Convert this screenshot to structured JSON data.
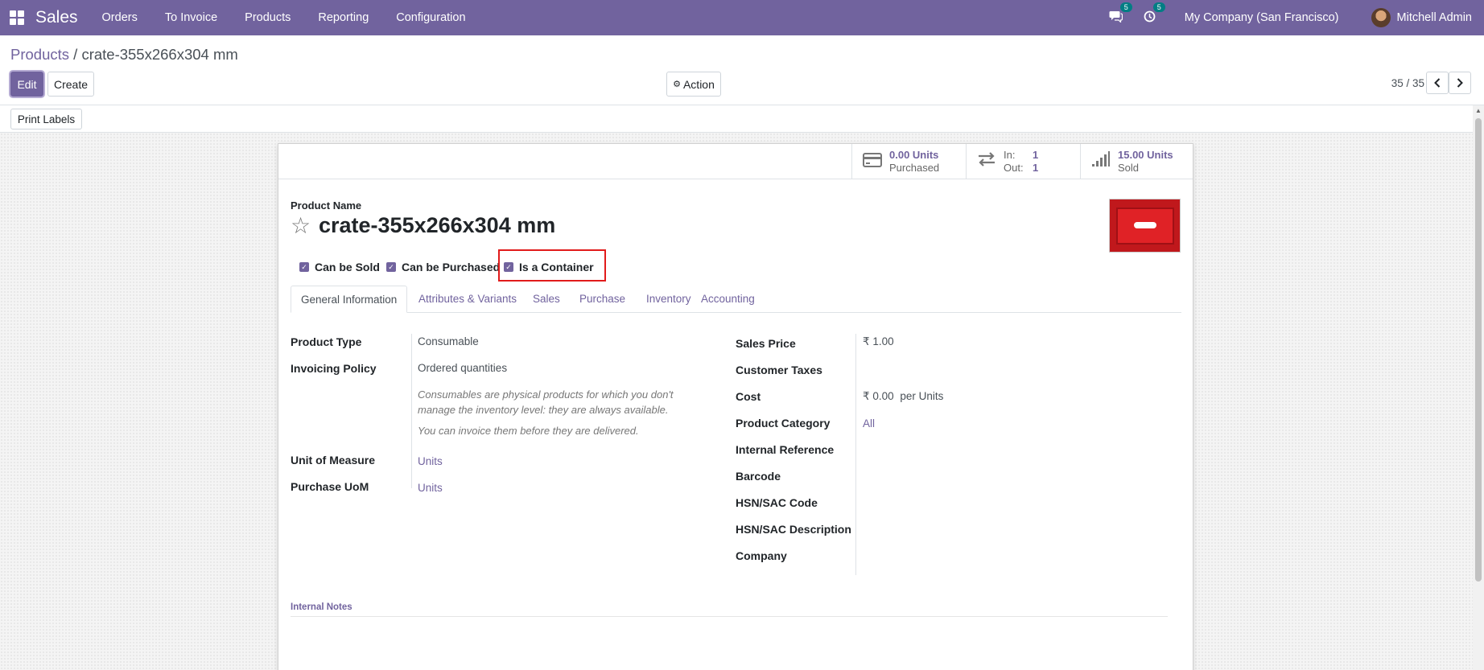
{
  "nav": {
    "app_name": "Sales",
    "menu": [
      "Orders",
      "To Invoice",
      "Products",
      "Reporting",
      "Configuration"
    ],
    "messages_count": "5",
    "activities_count": "5",
    "company": "My Company (San Francisco)",
    "user": "Mitchell Admin"
  },
  "breadcrumb": {
    "parent": "Products",
    "separator": "/",
    "current": "crate-355x266x304 mm"
  },
  "buttons": {
    "edit": "Edit",
    "create": "Create",
    "action": "Action",
    "print_labels": "Print Labels"
  },
  "pager": {
    "value": "35 / 35"
  },
  "smart_buttons": [
    {
      "value": "0.00 Units",
      "label": "Purchased",
      "icon": "credit-card-icon"
    },
    {
      "in_label": "In:",
      "in_value": "1",
      "out_label": "Out:",
      "out_value": "1",
      "icon": "exchange-arrows-icon"
    },
    {
      "value": "15.00 Units",
      "label": "Sold",
      "icon": "signal-bars-icon"
    }
  ],
  "product": {
    "name_label": "Product Name",
    "name": "crate-355x266x304 mm",
    "checkboxes": [
      {
        "label": "Can be Sold",
        "checked": true
      },
      {
        "label": "Can be Purchased",
        "checked": true
      },
      {
        "label": "Is a Container",
        "checked": true
      }
    ]
  },
  "tabs": [
    "General Information",
    "Attributes & Variants",
    "Sales",
    "Purchase",
    "Inventory",
    "Accounting"
  ],
  "general_left": {
    "product_type_label": "Product Type",
    "product_type": "Consumable",
    "invoicing_policy_label": "Invoicing Policy",
    "invoicing_policy": "Ordered quantities",
    "help_1": "Consumables are physical products for which you don't manage the inventory level: they are always available.",
    "help_2": "You can invoice them before they are delivered.",
    "uom_label": "Unit of Measure",
    "uom": "Units",
    "purchase_uom_label": "Purchase UoM",
    "purchase_uom": "Units"
  },
  "general_right": {
    "sales_price_label": "Sales Price",
    "sales_price": "₹ 1.00",
    "customer_taxes_label": "Customer Taxes",
    "cost_label": "Cost",
    "cost": "₹ 0.00",
    "cost_unit": "per Units",
    "category_label": "Product Category",
    "category": "All",
    "internal_ref_label": "Internal Reference",
    "barcode_label": "Barcode",
    "hsn_code_label": "HSN/SAC Code",
    "hsn_desc_label": "HSN/SAC Description",
    "company_label": "Company"
  },
  "notes": {
    "label": "Internal Notes"
  },
  "colors": {
    "brand": "#71639e",
    "badge": "#017e84",
    "highlight": "#e11b1b"
  }
}
